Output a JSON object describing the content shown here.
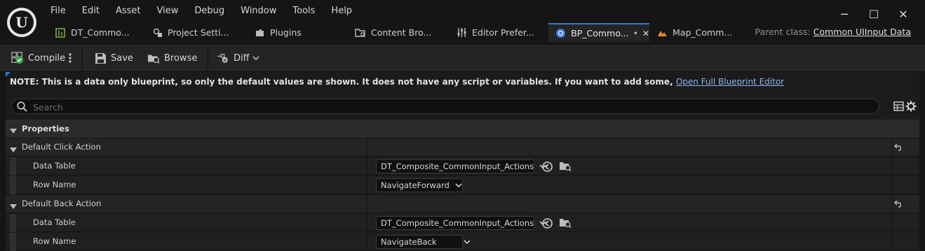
{
  "app": {
    "logo": "U",
    "menu": [
      "File",
      "Edit",
      "Asset",
      "View",
      "Debug",
      "Window",
      "Tools",
      "Help"
    ],
    "window_controls": {
      "minimize": "─",
      "maximize": "☐",
      "close": "✕"
    }
  },
  "tabs": [
    {
      "label": "DT_Commo...",
      "icon": "datatable-icon"
    },
    {
      "label": "Project Setti...",
      "icon": "project-settings-icon"
    },
    {
      "label": "Plugins",
      "icon": "plugins-icon"
    },
    {
      "label": "Content Bro...",
      "icon": "content-browser-icon"
    },
    {
      "label": "Editor Prefer...",
      "icon": "sliders-icon"
    },
    {
      "label": "BP_Commo...",
      "icon": "blueprint-icon",
      "active": true,
      "dirty": "•"
    },
    {
      "label": "Map_Comm...",
      "icon": "map-icon"
    }
  ],
  "parent_class": {
    "label": "Parent class:",
    "value": "Common UIInput Data"
  },
  "toolbar": {
    "compile": "Compile",
    "save": "Save",
    "browse": "Browse",
    "diff": "Diff"
  },
  "notice": {
    "text": "NOTE: This is a data only blueprint, so only the default values are shown.  It does not have any script or variables.  If you want to add some, ",
    "link": "Open Full Blueprint Editor"
  },
  "search": {
    "placeholder": "Search",
    "value": ""
  },
  "properties": {
    "header": "Properties",
    "groups": [
      {
        "label": "Default Click Action",
        "rows": [
          {
            "name": "Data Table",
            "value": "DT_Composite_CommonInput_Actions"
          },
          {
            "name": "Row Name",
            "value": "NavigateForward"
          }
        ]
      },
      {
        "label": "Default Back Action",
        "rows": [
          {
            "name": "Data Table",
            "value": "DT_Composite_CommonInput_Actions"
          },
          {
            "name": "Row Name",
            "value": "NavigateBack"
          }
        ]
      }
    ]
  },
  "colors": {
    "accent": "#2a7be0",
    "link": "#8cb6ee",
    "background": "#151515",
    "panel": "#242424"
  }
}
